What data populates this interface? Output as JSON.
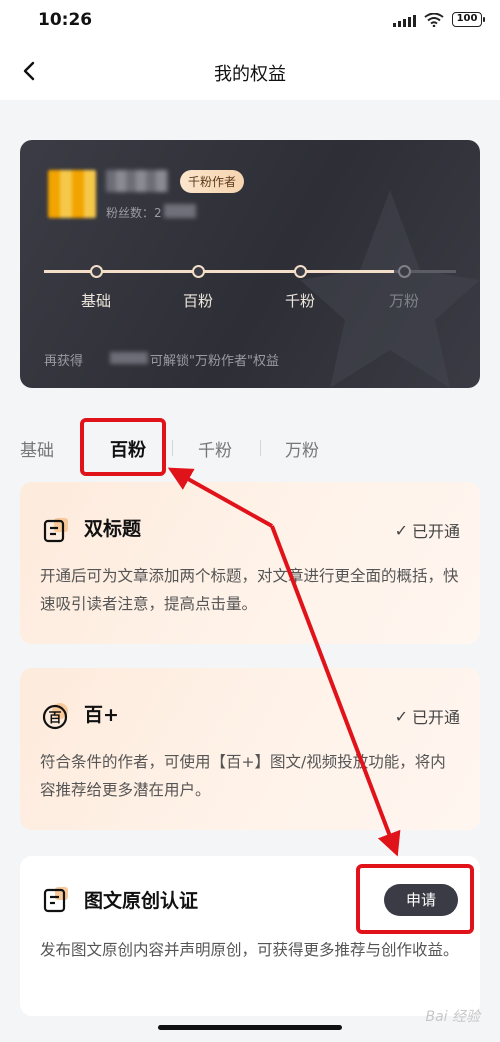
{
  "status_bar": {
    "time": "10:26",
    "battery": "100"
  },
  "nav": {
    "title": "我的权益"
  },
  "level_card": {
    "badge": "千粉作者",
    "fans_label": "粉丝数：",
    "fans_value_visible": "2",
    "levels": [
      "基础",
      "百粉",
      "千粉",
      "万粉"
    ],
    "progress_percent": 85,
    "unlock_prefix": "再获得",
    "unlock_suffix": "可解锁\"万粉作者\"权益"
  },
  "tabs": [
    "基础",
    "百粉",
    "千粉",
    "万粉"
  ],
  "active_tab": "百粉",
  "features": [
    {
      "icon": "double-title-icon",
      "title": "双标题",
      "status": "已开通",
      "description": "开通后可为文章添加两个标题，对文章进行更全面的概括，快速吸引读者注意，提高点击量。"
    },
    {
      "icon": "bai-plus-icon",
      "title": "百+",
      "status": "已开通",
      "description": "符合条件的作者，可使用【百+】图文/视频投放功能，将内容推荐给更多潜在用户。"
    },
    {
      "icon": "original-cert-icon",
      "title": "图文原创认证",
      "action": "申请",
      "description": "发布图文原创内容并声明原创，可获得更多推荐与创作收益。"
    }
  ],
  "colors": {
    "annotation": "#e1131a",
    "card_dark": "#2d2e36",
    "accent_gold": "#f3dfc7"
  },
  "watermark": "Bai 经验"
}
